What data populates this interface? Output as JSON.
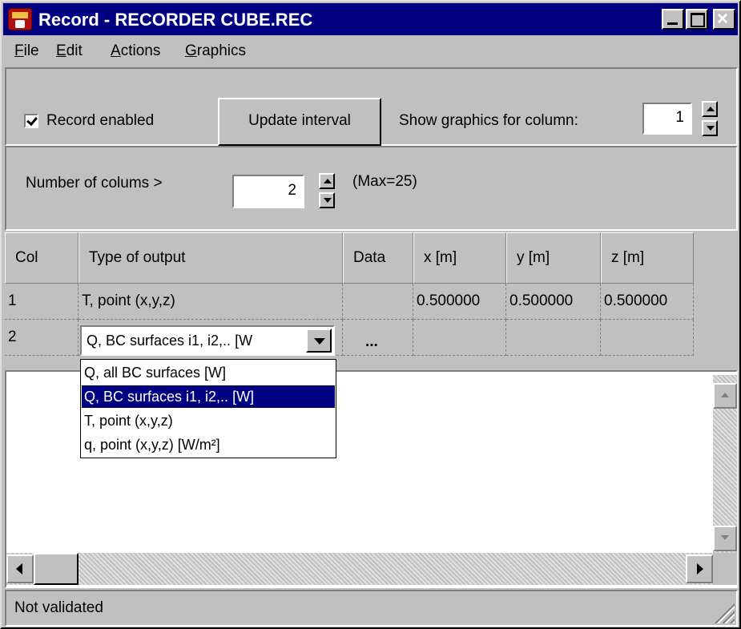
{
  "window": {
    "title": "Record - RECORDER CUBE.REC",
    "icon": "app-icon"
  },
  "menu": [
    "File",
    "Edit",
    "Actions",
    "Graphics"
  ],
  "toolbar": {
    "record_enabled_label": "Record enabled",
    "record_enabled_checked": true,
    "update_interval_label": "Update interval",
    "show_graphics_label": "Show graphics for column:",
    "show_graphics_value": "1"
  },
  "columns": {
    "label": "Number of colums  >",
    "value": "2",
    "max_label": "(Max=25)"
  },
  "grid": {
    "headers": [
      "Col",
      "Type of output",
      "Data",
      "x [m]",
      "y [m]",
      "z [m]"
    ],
    "rows": [
      [
        "1",
        "T, point (x,y,z)",
        "",
        "0.500000",
        "0.500000",
        "0.500000"
      ],
      [
        "2",
        "Q, BC surfaces i1, i2,.. [W]",
        "...",
        "",
        "",
        ""
      ]
    ],
    "combo_value": "Q, BC surfaces i1, i2,.. [W"
  },
  "dropdown": {
    "options": [
      "Q, all BC surfaces [W]",
      "Q, BC surfaces i1, i2,.. [W]",
      "T, point (x,y,z)",
      "q, point (x,y,z)  [W/m²]"
    ],
    "selected_index": 1
  },
  "status": {
    "text": "Not validated"
  },
  "colors": {
    "titlebar": "#000080",
    "face": "#c0c0c0",
    "selection": "#000080"
  }
}
